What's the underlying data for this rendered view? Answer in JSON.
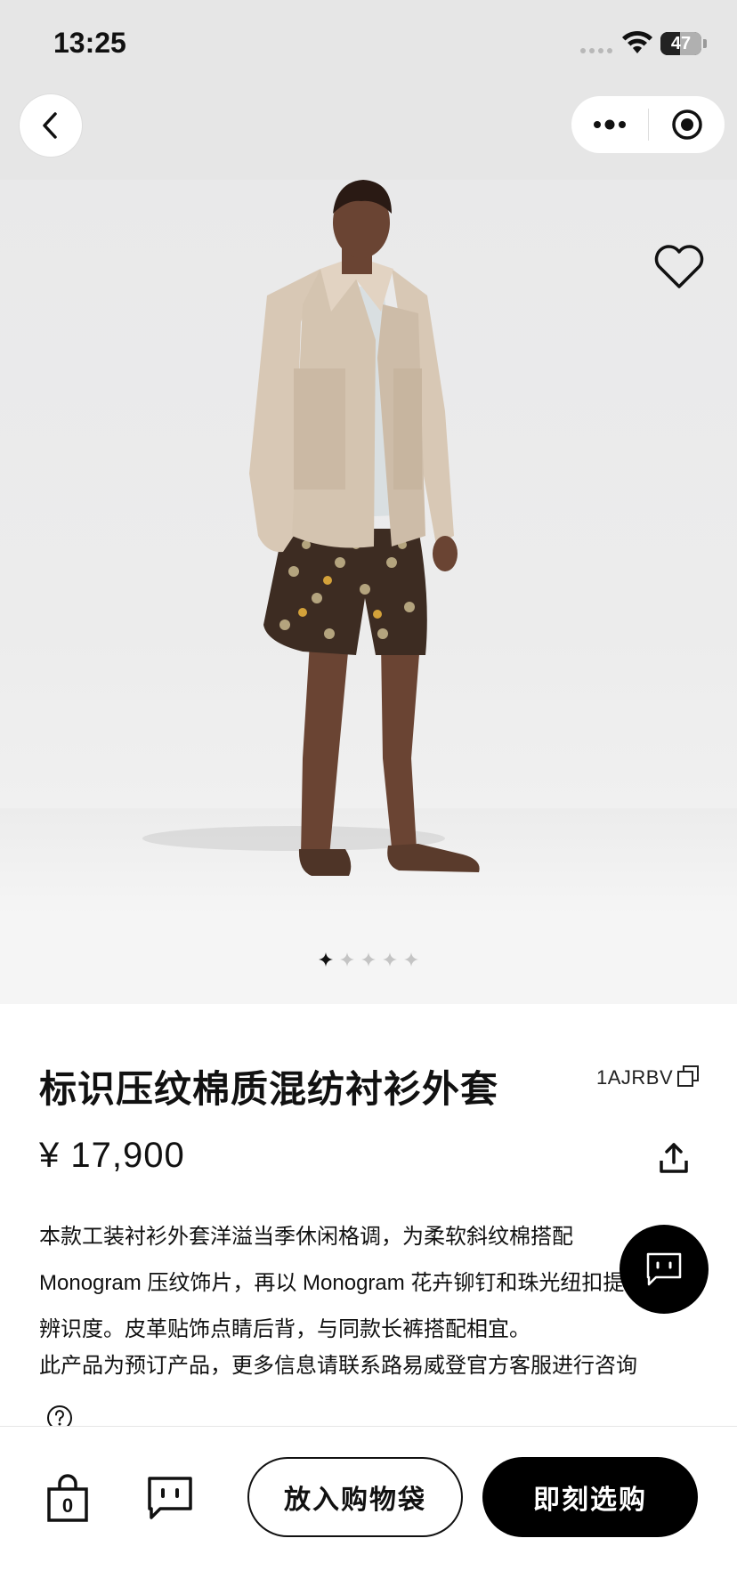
{
  "status_bar": {
    "time": "13:25",
    "battery": "47",
    "battery_level": 0.47
  },
  "product": {
    "title": "标识压纹棉质混纺衬衫外套",
    "sku": "1AJRBV",
    "price": "¥ 17,900",
    "description_lines": [
      "本款工装衬衫外套洋溢当季休闲格调，为柔软斜纹棉搭配",
      "Monogram 压纹饰片，再以 Monogram 花卉铆钉和珠光纽扣提升",
      "辨识度。皮革贴饰点睛后背，与同款长裤搭配相宜。"
    ],
    "preorder_note": "此产品为预订产品，更多信息请联系路易威登官方客服进行咨询"
  },
  "gallery": {
    "total": 5,
    "active": 0
  },
  "bottom_bar": {
    "bag_count": "0",
    "add_to_bag_label": "放入购物袋",
    "buy_now_label": "即刻选购"
  },
  "colors": {
    "background": "#ffffff",
    "header_bg": "#e6e6e6",
    "primary": "#000000"
  },
  "icons": [
    "back-icon",
    "more-icon",
    "close-target-icon",
    "heart-icon",
    "copy-icon",
    "share-icon",
    "help-icon",
    "chat-icon",
    "bag-icon",
    "message-icon",
    "wifi-icon"
  ]
}
